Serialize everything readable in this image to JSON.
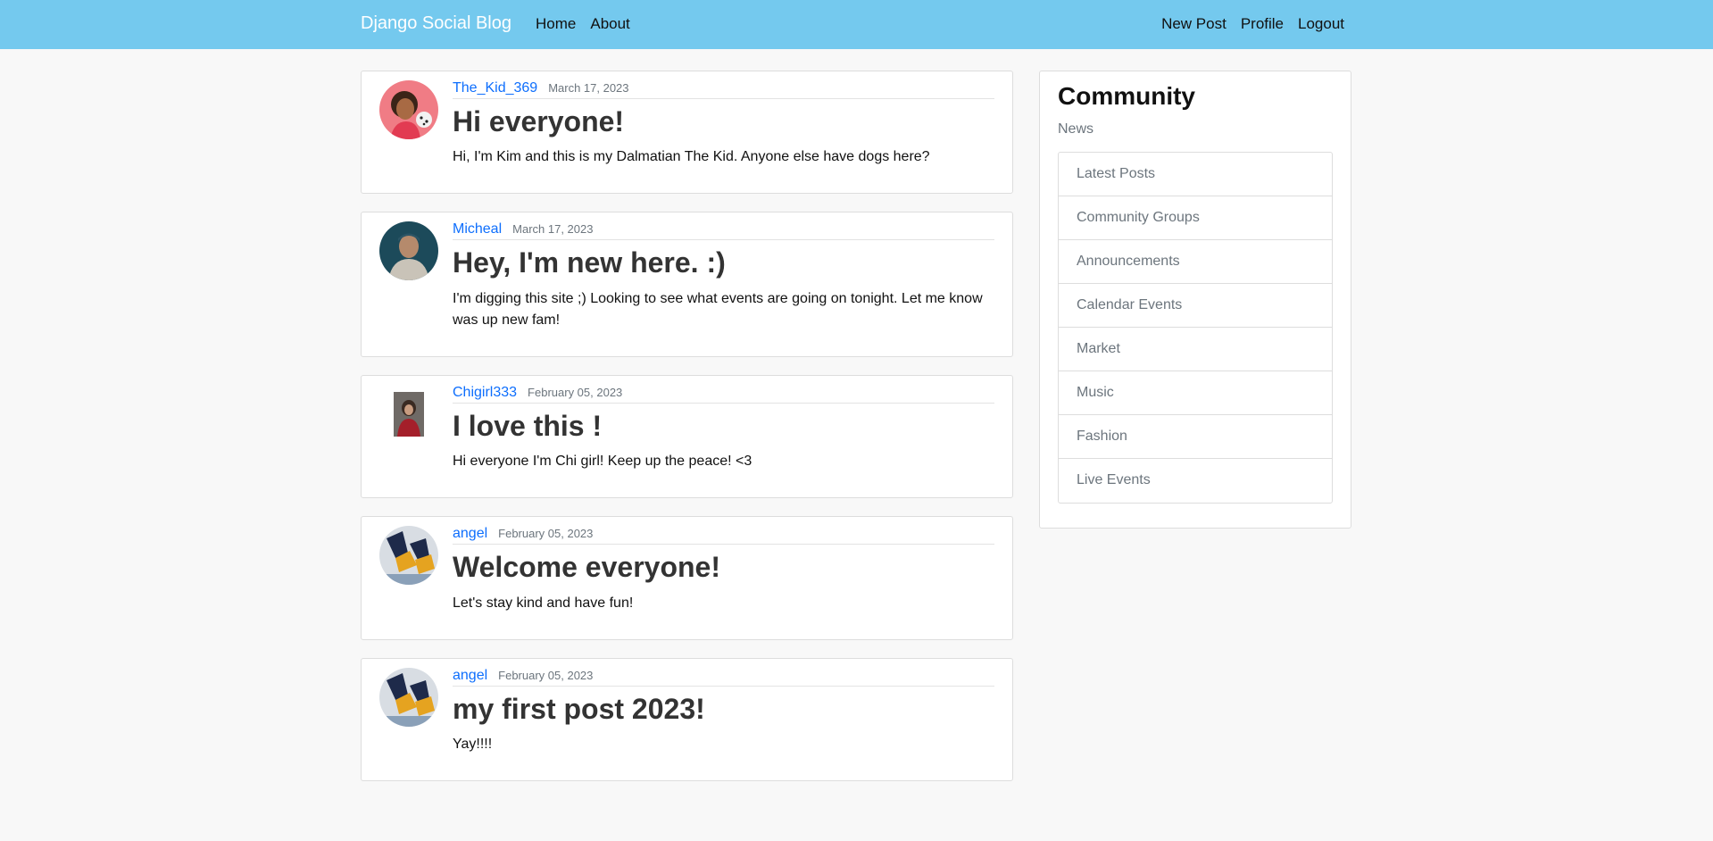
{
  "nav": {
    "brand": "Django Social Blog",
    "left": [
      "Home",
      "About"
    ],
    "right": [
      "New Post",
      "Profile",
      "Logout"
    ]
  },
  "posts": [
    {
      "author": "The_Kid_369",
      "date": "March 17, 2023",
      "title": "Hi everyone!",
      "body": "Hi, I'm Kim and this is my Dalmatian The Kid. Anyone else have dogs here?"
    },
    {
      "author": "Micheal",
      "date": "March 17, 2023",
      "title": "Hey, I'm new here. :)",
      "body": "I'm digging this site ;) Looking to see what events are going on tonight. Let me know was up new fam!"
    },
    {
      "author": "Chigirl333",
      "date": "February 05, 2023",
      "title": "I love this !",
      "body": "Hi everyone I'm Chi girl! Keep up the peace! <3"
    },
    {
      "author": "angel",
      "date": "February 05, 2023",
      "title": "Welcome everyone!",
      "body": "Let's stay kind and have fun!"
    },
    {
      "author": "angel",
      "date": "February 05, 2023",
      "title": "my first post 2023!",
      "body": "Yay!!!!"
    }
  ],
  "sidebar": {
    "title": "Community",
    "subtitle": "News",
    "items": [
      "Latest Posts",
      "Community Groups",
      "Announcements",
      "Calendar Events",
      "Market",
      "Music",
      "Fashion",
      "Live Events"
    ]
  },
  "colors": {
    "navbar": "#74c9ee",
    "link": "#0d6efd",
    "background": "#f8f8f8"
  }
}
